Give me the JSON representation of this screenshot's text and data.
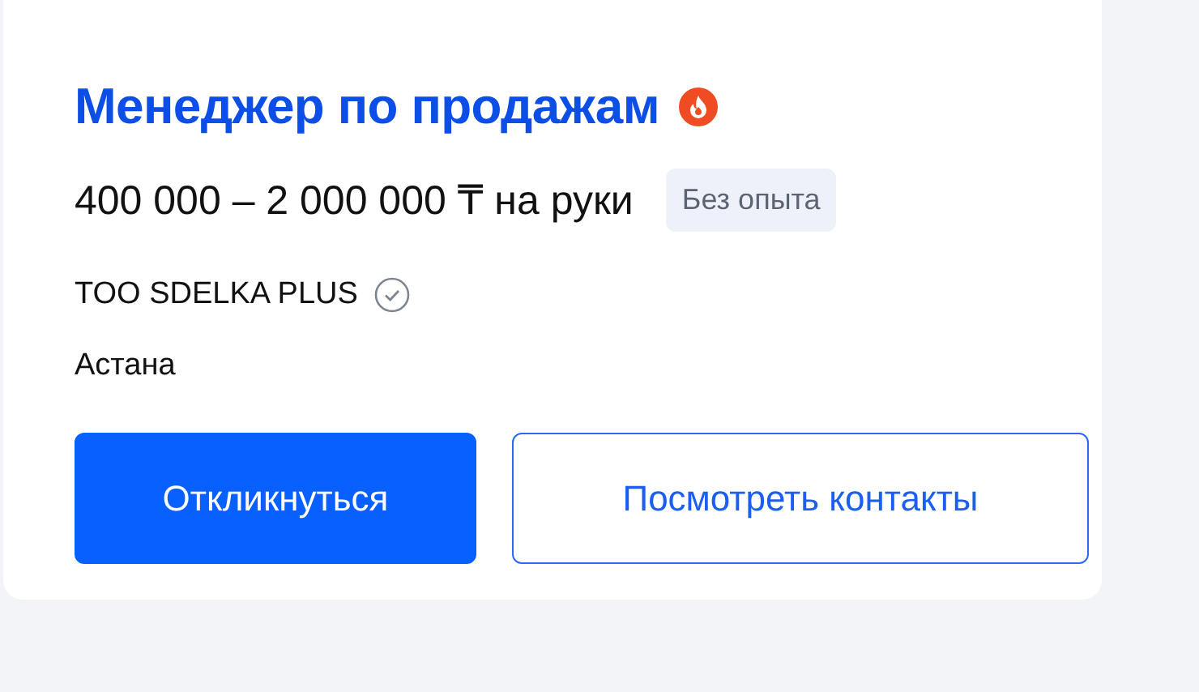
{
  "vacancy": {
    "title": "Менеджер по продажам",
    "hot": true,
    "salary": "400 000 – 2 000 000 ₸ на руки",
    "experience_badge": "Без опыта",
    "company": {
      "name": "TOO SDELKA PLUS",
      "verified": true
    },
    "city": "Астана",
    "buttons": [
      {
        "label": "Откликнуться",
        "kind": "primary"
      },
      {
        "label": "Посмотреть контакты",
        "kind": "secondary"
      }
    ]
  }
}
